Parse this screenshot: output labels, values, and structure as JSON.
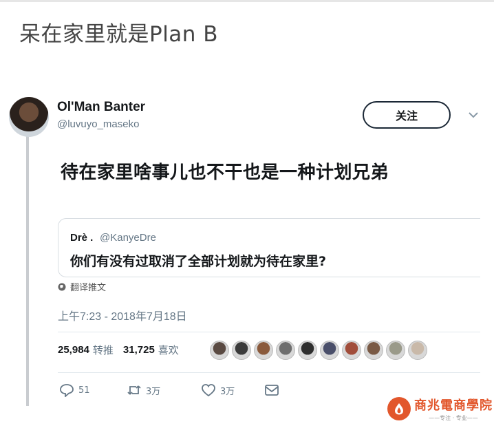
{
  "post": {
    "title": "呆在家里就是Plan B"
  },
  "tweet": {
    "author_name": "Ol'Man Banter",
    "author_handle": "@luvuyo_maseko",
    "follow_label": "关注",
    "text": "待在家里啥事儿也不干也是一种计划兄弟",
    "translate_label": "翻译推文",
    "timestamp": "上午7:23 - 2018年7月18日"
  },
  "quote": {
    "author_name": "Drè .",
    "author_handle": "@KanyeDre",
    "text": "你们有没有过取消了全部计划就为待在家里?"
  },
  "stats": {
    "retweets_count": "25,984",
    "retweets_label": "转推",
    "likes_count": "31,725",
    "likes_label": "喜欢"
  },
  "actions": {
    "reply_count": "51",
    "retweet_count": "3万",
    "like_count": "3万"
  },
  "liker_avatars": [
    "#5a4a42",
    "#3b3b3b",
    "#8a5a3c",
    "#6e6e6e",
    "#2e2e2e",
    "#4a4f6a",
    "#a14d3a",
    "#7a5a45",
    "#9a9a8a",
    "#c9b9a9"
  ],
  "watermark": {
    "title": "商兆電商學院",
    "subtitle": "——专注 · 专业——"
  },
  "colors": {
    "text_primary": "#14171a",
    "text_secondary": "#657786",
    "divider": "#e1e8ed",
    "watermark": "#e2572c"
  },
  "icons": [
    "globe-icon",
    "reply-icon",
    "retweet-icon",
    "heart-icon",
    "message-icon",
    "chevron-down-icon",
    "watermark-logo-icon"
  ]
}
